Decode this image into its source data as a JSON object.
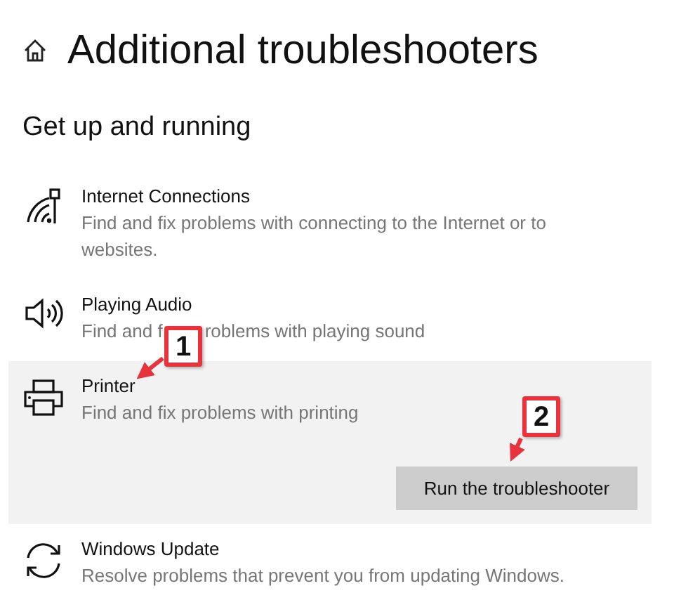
{
  "page": {
    "title": "Additional troubleshooters"
  },
  "section": {
    "title": "Get up and running"
  },
  "items": [
    {
      "title": "Internet Connections",
      "description": "Find and fix problems with connecting to the Internet or to websites.",
      "selected": false
    },
    {
      "title": "Playing Audio",
      "description_parts": [
        "Find and f",
        "roblems with playing sound"
      ],
      "selected": false
    },
    {
      "title": "Printer",
      "description": "Find and fix problems with printing",
      "selected": true,
      "button": "Run the troubleshooter"
    },
    {
      "title": "Windows Update",
      "description": "Resolve problems that prevent you from updating Windows.",
      "selected": false
    }
  ],
  "callouts": [
    {
      "label": "1"
    },
    {
      "label": "2"
    }
  ]
}
